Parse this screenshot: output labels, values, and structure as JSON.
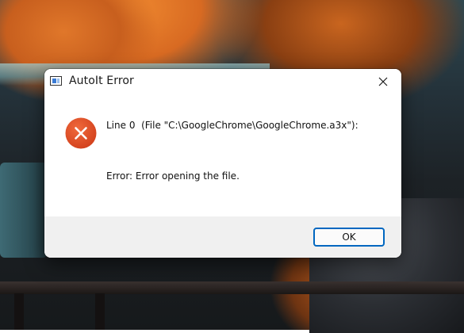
{
  "dialog": {
    "title": "AutoIt Error",
    "message_line1": "Line 0  (File \"C:\\GoogleChrome\\GoogleChrome.a3x\"):",
    "message_line2": "Error: Error opening the file.",
    "ok_label": "OK",
    "error_icon": "error-x-icon",
    "accent_color": "#0067c0",
    "error_color": "#e2502a"
  }
}
